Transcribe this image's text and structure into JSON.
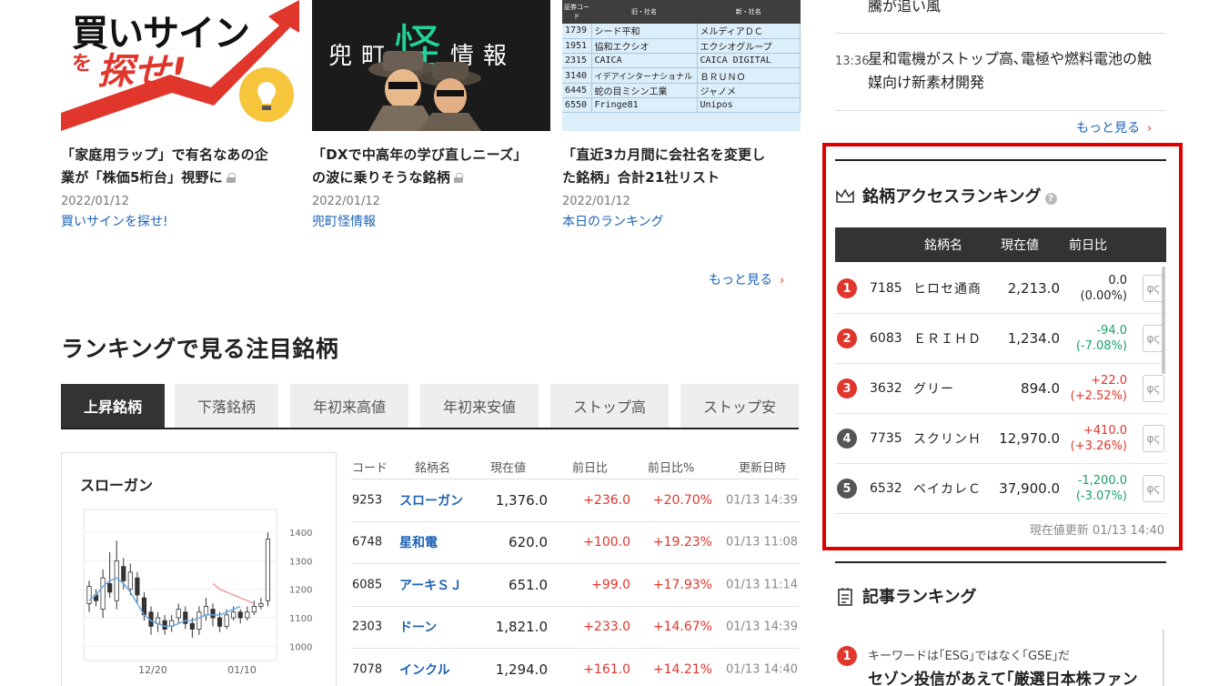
{
  "cards": [
    {
      "thumb_line1": "買いサイン",
      "thumb_line2a": "を",
      "thumb_line2b": "探せ!",
      "title_l1": "「家庭用ラップ」で有名なあの企",
      "title_l2": "業が「株価5桁台」視野に",
      "date": "2022/01/12",
      "category": "買いサインを探せ!"
    },
    {
      "thumb_a": "兜町",
      "thumb_b": "怪",
      "thumb_c": "情報",
      "title_l1": "「DXで中高年の学び直しニーズ」",
      "title_l2": "の波に乗りそうな銘柄",
      "date": "2022/01/12",
      "category": "兜町怪情報"
    },
    {
      "title_l1": "「直近3カ月間に会社名を変更し",
      "title_l2": "た銘柄」合計21社リスト",
      "date": "2022/01/12",
      "category": "本日のランキング"
    }
  ],
  "rename_table": {
    "headers": [
      "証券コード",
      "旧・社名",
      "新・社名"
    ],
    "rows": [
      [
        "1739",
        "シード平和",
        "メルディアＤＣ"
      ],
      [
        "1951",
        "協和エクシオ",
        "エクシオグループ"
      ],
      [
        "2315",
        "CAICA",
        "CAICA DIGITAL"
      ],
      [
        "3140",
        "イデアインターナショナル",
        "ＢＲＵＮＯ"
      ],
      [
        "6445",
        "蛇の目ミシン工業",
        "ジャノメ"
      ],
      [
        "6550",
        "Fringe81",
        "Unipos"
      ]
    ]
  },
  "more_label": "もっと見る",
  "chev": "›",
  "ranking_section": {
    "title": "ランキングで見る注目銘柄",
    "tabs": [
      "上昇銘柄",
      "下落銘柄",
      "年初来高値",
      "年初来安値",
      "ストップ高",
      "ストップ安"
    ]
  },
  "chart_data": {
    "type": "candlestick",
    "title": "スローガン",
    "y_ticks": [
      1000,
      1100,
      1200,
      1300,
      1400
    ],
    "x_ticks": [
      "12/20",
      "01/10"
    ],
    "ylim": [
      950,
      1480
    ]
  },
  "gainers": {
    "headers": [
      "コード",
      "銘柄名",
      "現在値",
      "前日比",
      "前日比%",
      "更新日時"
    ],
    "rows": [
      {
        "code": "9253",
        "name": "スローガン",
        "price": "1,376.0",
        "change": "+236.0",
        "pct": "+20.70%",
        "time": "01/13 14:39"
      },
      {
        "code": "6748",
        "name": "星和電",
        "price": "620.0",
        "change": "+100.0",
        "pct": "+19.23%",
        "time": "01/13 11:08"
      },
      {
        "code": "6085",
        "name": "アーキＳＪ",
        "price": "651.0",
        "change": "+99.0",
        "pct": "+17.93%",
        "time": "01/13 11:14"
      },
      {
        "code": "2303",
        "name": "ドーン",
        "price": "1,821.0",
        "change": "+233.0",
        "pct": "+14.67%",
        "time": "01/13 14:39"
      },
      {
        "code": "7078",
        "name": "インクル",
        "price": "1,294.0",
        "change": "+161.0",
        "pct": "+14.21%",
        "time": "01/13 14:40"
      }
    ]
  },
  "news": [
    {
      "time": "",
      "text": "騰が追い風"
    },
    {
      "time": "13:36",
      "text": "星和電機がストップ高､電極や燃料電池の触媒向け新素材開発"
    }
  ],
  "access_ranking": {
    "title": "銘柄アクセスランキング",
    "help": "?",
    "headers": [
      "銘柄名",
      "現在値",
      "前日比"
    ],
    "rows": [
      {
        "rank": "1",
        "code": "7185",
        "name": "ヒロセ通商",
        "price": "2,213.0",
        "chg": "0.0",
        "pct": "(0.00%)",
        "dir": "flat"
      },
      {
        "rank": "2",
        "code": "6083",
        "name": "ＥＲＩＨＤ",
        "price": "1,234.0",
        "chg": "-94.0",
        "pct": "(-7.08%)",
        "dir": "down"
      },
      {
        "rank": "3",
        "code": "3632",
        "name": "グリー",
        "price": "894.0",
        "chg": "+22.0",
        "pct": "(+2.52%)",
        "dir": "up"
      },
      {
        "rank": "4",
        "code": "7735",
        "name": "スクリンＨ",
        "price": "12,970.0",
        "chg": "+410.0",
        "pct": "(+3.26%)",
        "dir": "up"
      },
      {
        "rank": "5",
        "code": "6532",
        "name": "ベイカレＣ",
        "price": "37,900.0",
        "chg": "-1,200.0",
        "pct": "(-3.07%)",
        "dir": "down"
      }
    ],
    "updated": "現在値更新 01/13 14:40"
  },
  "article_ranking": {
    "title": "記事ランキング",
    "items": [
      {
        "rank": "1",
        "line1": "キーワードは｢ESG｣ではなく｢GSE｣だ",
        "line2": "セゾン投信があえて｢厳選日本株ファン"
      }
    ]
  },
  "colors": {
    "up": "#e0362c",
    "down": "#1aa266",
    "link": "#1e63b6",
    "highlight": "#e00000",
    "rank_top": "#e0362c",
    "rank_other": "#555555"
  }
}
